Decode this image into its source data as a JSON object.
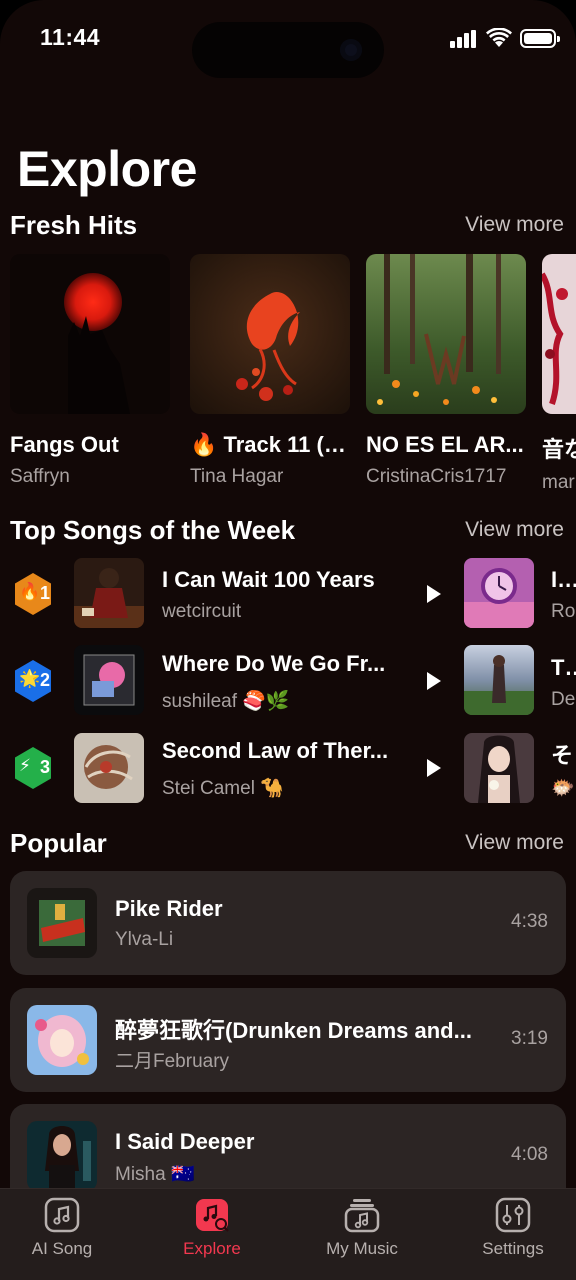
{
  "status_bar": {
    "time": "11:44"
  },
  "page_title": "Explore",
  "fresh_hits": {
    "title": "Fresh Hits",
    "view_more": "View more",
    "items": [
      {
        "title": "Fangs Out",
        "artist": "Saffryn"
      },
      {
        "title": "🔥 Track 11 (B...",
        "artist": "Tina Hagar"
      },
      {
        "title": "NO ES EL AR...",
        "artist": "CristinaCris1717"
      },
      {
        "title": "音な",
        "artist": "mar"
      }
    ]
  },
  "top_songs": {
    "title": "Top Songs of the Week",
    "view_more": "View more",
    "items": [
      {
        "rank": "1",
        "rank_emoji": "🔥",
        "title": "I Can Wait 100 Years",
        "artist": "wetcircuit",
        "next_title": "It’s",
        "next_artist": "Ro"
      },
      {
        "rank": "2",
        "rank_emoji": "🌟",
        "title": "Where Do We Go Fr...",
        "artist": "sushileaf 🍣🌿",
        "next_title": "Th",
        "next_artist": "De"
      },
      {
        "rank": "3",
        "rank_emoji": "⚡",
        "title": "Second Law of Ther...",
        "artist": "Stei Camel 🐪",
        "next_title": "そ",
        "next_artist": "🐡"
      }
    ]
  },
  "popular": {
    "title": "Popular",
    "view_more": "View more",
    "items": [
      {
        "title": "Pike Rider",
        "artist": "Ylva-Li",
        "duration": "4:38"
      },
      {
        "title": "醉夢狂歌行(Drunken Dreams and...",
        "artist": "二月February",
        "duration": "3:19"
      },
      {
        "title": "I Said Deeper",
        "artist": "Misha 🇦🇺",
        "duration": "4:08"
      }
    ]
  },
  "tab_bar": {
    "tabs": [
      {
        "label": "AI Song",
        "icon": "music-note-icon"
      },
      {
        "label": "Explore",
        "icon": "explore-music-search-icon"
      },
      {
        "label": "My Music",
        "icon": "music-library-icon"
      },
      {
        "label": "Settings",
        "icon": "sliders-icon"
      }
    ],
    "active": "Explore"
  },
  "colors": {
    "background": "#120807",
    "card": "#2c2524",
    "accent": "#f2384f",
    "muted_text": "#a9a2a1"
  }
}
